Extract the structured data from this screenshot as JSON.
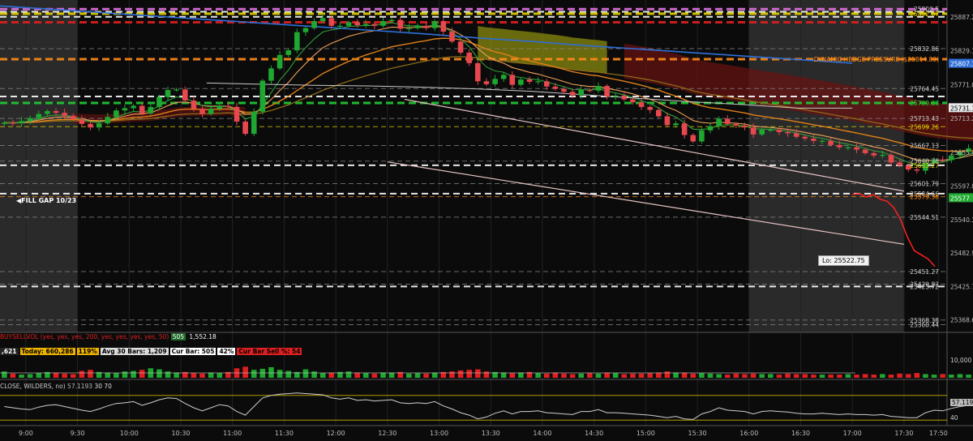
{
  "colors": {
    "background": "#0b0b0b",
    "session_shade": "#2a2a2a",
    "up": "#1fa831",
    "down": "#e6484e",
    "ema_fast": "#2e9e3a",
    "ema_mid": "#e0801a",
    "ema_slow": "#8a6a1a",
    "vwap": "#e8c6c6",
    "sma_white": "#c9c9c9",
    "sma_blue": "#2f6fd8",
    "cloud_red": "#6b1111",
    "cloud_yellow": "#8a8a10",
    "hline_orange": "#ff8c1a",
    "hline_green": "#22cc33",
    "hline_red": "#e02020",
    "hline_yellow": "#e6d200",
    "hline_pink": "#e070e0"
  },
  "right_axis_labels": [
    {
      "text": "25887.25",
      "value": 25887.25,
      "style": "plain"
    },
    {
      "text": "25829.1",
      "value": 25829.1,
      "style": "plain"
    },
    {
      "text": "25807.1",
      "value": 25807.1,
      "style": "box-blue"
    },
    {
      "text": "25771.09",
      "value": 25771.09,
      "style": "plain"
    },
    {
      "text": "25731.1",
      "value": 25731.1,
      "style": "box-white"
    },
    {
      "text": "25713.2",
      "value": 25713.2,
      "style": "plain"
    },
    {
      "text": "25655.45",
      "value": 25655.45,
      "style": "plain"
    },
    {
      "text": "25597.8",
      "value": 25597.8,
      "style": "plain"
    },
    {
      "text": "25577",
      "value": 25577,
      "style": "box-green"
    },
    {
      "text": "25540.3",
      "value": 25540.3,
      "style": "plain"
    },
    {
      "text": "25482.9",
      "value": 25482.9,
      "style": "plain"
    },
    {
      "text": "25425.7",
      "value": 25425.7,
      "style": "plain"
    },
    {
      "text": "25368.6",
      "value": 25368.6,
      "style": "plain"
    }
  ],
  "level_labels": [
    {
      "text": "25900.5",
      "value": 25900.5,
      "color": "#cccccc"
    },
    {
      "text": "25892.67",
      "value": 25892.67,
      "color": "#e6d200"
    },
    {
      "text": "25832.86",
      "value": 25832.86,
      "color": "#cccccc"
    },
    {
      "text": "DYNAMIC HEDGE PRESSURE ($25814.89)",
      "value": 25814.89,
      "color": "#ff8c1a"
    },
    {
      "text": "25764.45",
      "value": 25764.45,
      "color": "#cccccc"
    },
    {
      "text": "25739.83",
      "value": 25739.83,
      "color": "#22cc33"
    },
    {
      "text": "25713.43",
      "value": 25713.43,
      "color": "#cccccc"
    },
    {
      "text": "25699.26",
      "value": 25699.26,
      "color": "#e6d200"
    },
    {
      "text": "25667.13",
      "value": 25667.13,
      "color": "#cccccc"
    },
    {
      "text": "25640.38",
      "value": 25640.38,
      "color": "#cccccc"
    },
    {
      "text": "25633.27",
      "value": 25633.27,
      "color": "#e6d200"
    },
    {
      "text": "25601.79",
      "value": 25601.79,
      "color": "#cccccc"
    },
    {
      "text": "25584.66",
      "value": 25584.66,
      "color": "#cccccc"
    },
    {
      "text": "25579.38",
      "value": 25579.38,
      "color": "#ff8c1a"
    },
    {
      "text": "25544.51",
      "value": 25544.51,
      "color": "#cccccc"
    },
    {
      "text": "25451.27",
      "value": 25451.27,
      "color": "#cccccc"
    },
    {
      "text": "25429.82",
      "value": 25429.82,
      "color": "#cccccc"
    },
    {
      "text": "25425.72",
      "value": 25425.72,
      "color": "#cccccc"
    },
    {
      "text": "25368.38",
      "value": 25368.38,
      "color": "#cccccc"
    },
    {
      "text": "25360.44",
      "value": 25360.44,
      "color": "#cccccc"
    }
  ],
  "hlines": [
    {
      "value": 25900.5,
      "color": "#e070e0",
      "style": "thick-dash"
    },
    {
      "value": 25896,
      "color": "#ffffff",
      "style": "dash"
    },
    {
      "value": 25892.67,
      "color": "#e6d200",
      "style": "thick-dash"
    },
    {
      "value": 25887.25,
      "color": "#ffffff",
      "style": "dash"
    },
    {
      "value": 25878,
      "color": "#e02020",
      "style": "thick-dash"
    },
    {
      "value": 25832.86,
      "color": "#888888",
      "style": "thin-dash"
    },
    {
      "value": 25814.89,
      "color": "#ff8c1a",
      "style": "thick-dash"
    },
    {
      "value": 25764.45,
      "color": "#888888",
      "style": "thin-dash"
    },
    {
      "value": 25751,
      "color": "#ffffff",
      "style": "dash"
    },
    {
      "value": 25739.83,
      "color": "#22cc33",
      "style": "thick-dash"
    },
    {
      "value": 25713.43,
      "color": "#888888",
      "style": "thin-dash"
    },
    {
      "value": 25699.26,
      "color": "#e6d200",
      "style": "thin-dash"
    },
    {
      "value": 25667.13,
      "color": "#888888",
      "style": "thin-dash"
    },
    {
      "value": 25640.38,
      "color": "#888888",
      "style": "thin-dash"
    },
    {
      "value": 25633.27,
      "color": "#ffffff",
      "style": "dash"
    },
    {
      "value": 25601.79,
      "color": "#888888",
      "style": "thin-dash"
    },
    {
      "value": 25584.66,
      "color": "#ffffff",
      "style": "dash"
    },
    {
      "value": 25579.38,
      "color": "#ff8c1a",
      "style": "thin-dash"
    },
    {
      "value": 25544.51,
      "color": "#888888",
      "style": "thin-dash"
    },
    {
      "value": 25451.27,
      "color": "#888888",
      "style": "thin-dash"
    },
    {
      "value": 25429.82,
      "color": "#888888",
      "style": "thin-dash"
    },
    {
      "value": 25425.72,
      "color": "#ffffff",
      "style": "dash"
    },
    {
      "value": 25368.38,
      "color": "#888888",
      "style": "thin-dash"
    },
    {
      "value": 25360.44,
      "color": "#888888",
      "style": "thin-dash"
    }
  ],
  "fill_gap_label": "FILL GAP 10/23",
  "low_label": "Lo: 25522.75",
  "volume_study": {
    "header": "BUYSELLVOL (yes, yes, yes, 200, yes, yes, yes, yes, 50)",
    "header_buy": "505",
    "header_value": "1,552.18",
    "stats": [
      {
        "text": ",621",
        "bg": "#222222",
        "fg": "#ffffff"
      },
      {
        "text": "Today: 660,286",
        "bg": "#f0b400",
        "fg": "#000000"
      },
      {
        "text": "119%",
        "bg": "#f0b400",
        "fg": "#000000"
      },
      {
        "text": "Avg 30 Bars: 1,209",
        "bg": "#dddddd",
        "fg": "#000000"
      },
      {
        "text": "Cur Bar: 505",
        "bg": "#ffffff",
        "fg": "#000000"
      },
      {
        "text": "42%",
        "bg": "#ffffff",
        "fg": "#000000"
      },
      {
        "text": "Cur Bar Sell %: 54",
        "bg": "#e02020",
        "fg": "#000000"
      }
    ],
    "axis_label": "10,000"
  },
  "rsi_study": {
    "header": "CLOSE, WILDERS, no)",
    "value": "57.1193",
    "lo": "30",
    "hi": "70",
    "axis_value": "57.1193",
    "axis_low": "40"
  },
  "time_labels": [
    "9:00",
    "9:30",
    "10:00",
    "10:30",
    "11:00",
    "11:30",
    "12:00",
    "12:30",
    "13:00",
    "13:30",
    "14:00",
    "14:30",
    "15:00",
    "15:30",
    "16:00",
    "16:30",
    "17:00",
    "17:30",
    "17:50"
  ],
  "chart_data": {
    "type": "candlestick",
    "title": "",
    "ylim": [
      25350,
      25905
    ],
    "x_start": "8:45",
    "x_end": "17:55",
    "bar_minutes": 5,
    "session_shade": [
      [
        "8:45",
        "9:30"
      ],
      [
        "16:00",
        "17:30"
      ]
    ],
    "closes": [
      25706,
      25705,
      25709,
      25714,
      25721,
      25726,
      25723,
      25718,
      25712,
      25704,
      25698,
      25705,
      25716,
      25727,
      25731,
      25735,
      25722,
      25733,
      25750,
      25762,
      25763,
      25744,
      25730,
      25721,
      25730,
      25735,
      25733,
      25708,
      25687,
      25725,
      25778,
      25799,
      25822,
      25830,
      25861,
      25868,
      25880,
      25885,
      25872,
      25872,
      25878,
      25873,
      25875,
      25872,
      25880,
      25882,
      25867,
      25868,
      25872,
      25868,
      25880,
      25862,
      25845,
      25826,
      25808,
      25777,
      25772,
      25781,
      25788,
      25771,
      25780,
      25776,
      25777,
      25768,
      25764,
      25759,
      25753,
      25762,
      25761,
      25769,
      25751,
      25752,
      25746,
      25741,
      25733,
      25728,
      25717,
      25702,
      25705,
      25685,
      25674,
      25693,
      25700,
      25713,
      25704,
      25701,
      25698,
      25686,
      25694,
      25694,
      25690,
      25688,
      25682,
      25679,
      25675,
      25675,
      25668,
      25664,
      25664,
      25660,
      25654,
      25650,
      25651,
      25638,
      25633,
      25626,
      25624,
      25637,
      25643,
      25642,
      25650,
      25656,
      25662,
      25667,
      25670,
      25666,
      25658,
      25654,
      25653,
      25650,
      25646,
      25641,
      25634,
      25626,
      25620,
      25610,
      25605,
      25598,
      25596,
      25601,
      25599,
      25604,
      25613,
      25622,
      25627,
      25628,
      25624,
      25629,
      25625,
      25627,
      25627,
      25633,
      25638,
      25628,
      25612,
      25597,
      25578,
      25568,
      25563,
      25561,
      25560,
      25562,
      25555,
      25547,
      25545,
      25538,
      25534,
      25540,
      25551,
      25560,
      25566,
      25570,
      25573,
      25579,
      25586
    ],
    "series": [
      {
        "name": "",
        "type": "line",
        "values": [
          25906,
          25900,
          25894,
          25888,
          25882,
          25876,
          25870,
          25864,
          25858,
          25851,
          25845,
          25838,
          25832,
          25826,
          25820,
          25814,
          25808
        ]
      },
      {
        "name": "",
        "type": "line",
        "values": [
          25774,
          25772,
          25770,
          25769,
          25767,
          25764,
          25760,
          25754,
          25748,
          25742,
          25737,
          25731,
          25731
        ]
      }
    ],
    "channel": {
      "upper": [
        [
          25746,
          "12:40"
        ],
        [
          25589,
          "17:30"
        ]
      ],
      "lower": [
        [
          25639,
          "12:30"
        ],
        [
          25498,
          "17:30"
        ]
      ]
    },
    "projection": [
      25583,
      25585,
      25579,
      25583,
      25575,
      25572,
      25561,
      25540,
      25510,
      25487,
      25480,
      25473,
      25460
    ],
    "volume_values": [
      1200,
      800,
      600,
      700,
      900,
      1100,
      1000,
      800,
      700,
      1300,
      1500,
      1100,
      1000,
      900,
      1200,
      1300,
      1500,
      1800,
      1600,
      1200,
      1000,
      1100,
      900,
      800,
      1000,
      900,
      1100,
      1800,
      2100,
      1500,
      1700,
      2000,
      1500,
      1300,
      1100,
      1600,
      1200,
      900,
      1000,
      1100,
      1200,
      1000,
      900,
      800,
      1000,
      1000,
      1100,
      800,
      900,
      800,
      1000,
      1100,
      1200,
      1400,
      1500,
      1600,
      1200,
      1100,
      1000,
      900,
      1000,
      1100,
      900,
      800,
      1000,
      800,
      700,
      800,
      900,
      800,
      1000,
      900,
      700,
      800,
      800,
      900,
      1000,
      1200,
      1000,
      1000,
      800,
      900,
      800,
      700,
      600,
      800,
      700,
      800,
      700,
      700,
      600,
      800,
      700,
      700,
      600,
      600,
      600,
      600,
      700,
      600,
      700,
      600,
      700,
      600,
      800,
      700,
      900,
      700,
      600,
      700,
      600,
      700,
      600,
      600,
      600,
      600,
      700,
      600,
      600,
      600,
      700,
      600,
      500,
      600,
      600,
      700,
      700,
      600,
      800,
      900,
      700,
      900,
      600,
      700,
      600,
      700,
      500,
      600,
      700,
      800,
      600,
      700,
      800,
      1500,
      1000,
      900,
      800,
      600,
      600,
      700,
      5200,
      1000,
      1200,
      800,
      700,
      600,
      700,
      600,
      800,
      700,
      600,
      600,
      500,
      600,
      600,
      505
    ],
    "rsi_values": [
      52,
      50,
      48,
      47,
      51,
      54,
      55,
      52,
      49,
      46,
      44,
      48,
      53,
      57,
      58,
      60,
      54,
      58,
      63,
      66,
      65,
      57,
      50,
      45,
      50,
      55,
      53,
      44,
      38,
      52,
      66,
      70,
      72,
      73,
      74,
      73,
      72,
      71,
      66,
      64,
      66,
      62,
      63,
      61,
      62,
      63,
      58,
      57,
      58,
      57,
      60,
      53,
      48,
      42,
      38,
      32,
      35,
      41,
      45,
      40,
      44,
      44,
      45,
      42,
      41,
      40,
      39,
      44,
      44,
      47,
      42,
      42,
      41,
      40,
      39,
      38,
      36,
      34,
      36,
      32,
      31,
      40,
      44,
      50,
      46,
      45,
      44,
      40,
      44,
      45,
      44,
      43,
      41,
      40,
      40,
      41,
      40,
      39,
      40,
      39,
      39,
      38,
      39,
      36,
      35,
      34,
      34,
      42,
      46,
      45,
      49,
      52,
      54,
      56,
      56,
      52,
      48,
      47,
      46,
      45,
      44,
      43,
      41,
      39,
      38,
      36,
      35,
      34,
      34,
      39,
      38,
      41,
      46,
      50,
      53,
      53,
      51,
      52,
      50,
      51,
      51,
      53,
      55,
      49,
      43,
      39,
      33,
      32,
      33,
      34,
      35,
      36,
      35,
      34,
      34,
      33,
      33,
      39,
      45,
      50,
      53,
      55,
      56,
      57,
      57
    ]
  }
}
